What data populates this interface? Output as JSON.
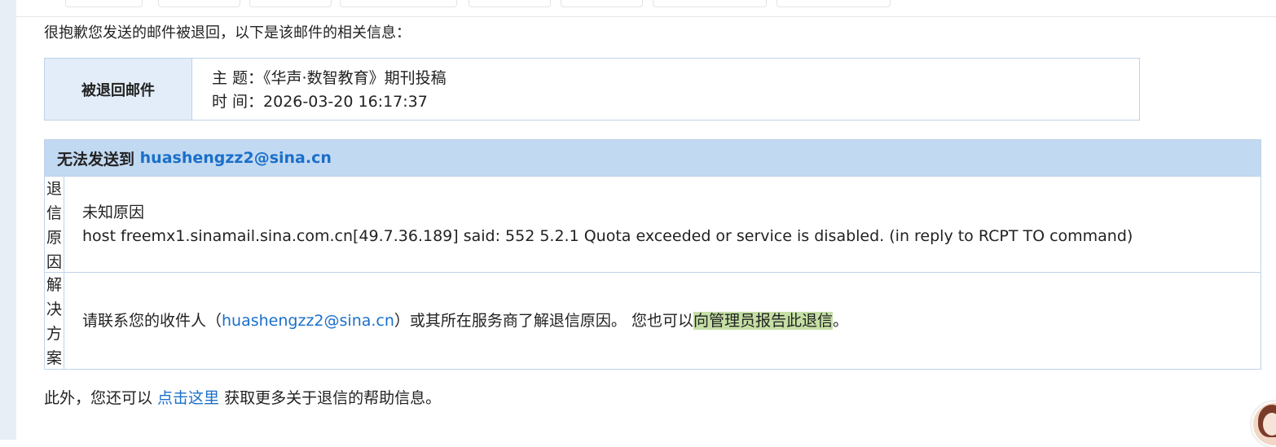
{
  "intro": "很抱歉您发送的邮件被退回，以下是该邮件的相关信息：",
  "bounced": {
    "label": "被退回邮件",
    "subject_label": "主 题：",
    "subject": "《华声·数智教育》期刊投稿",
    "time_label": "时 间：",
    "time": "2026-03-20 16:17:37"
  },
  "failure": {
    "header_prefix": "无法发送到",
    "recipient": "huashengzz2@sina.cn",
    "reason_label": [
      "退",
      "信",
      "原",
      "因"
    ],
    "reason_title": "未知原因",
    "reason_detail": "host freemx1.sinamail.sina.com.cn[49.7.36.189] said: 552 5.2.1 Quota exceeded or service is disabled. (in reply to RCPT TO command)",
    "solution_label": [
      "解",
      "决",
      "方",
      "案"
    ],
    "solution_prefix": "请联系您的收件人（",
    "solution_email": "huashengzz2@sina.cn",
    "solution_middle": "）或其所在服务商了解退信原因。 您也可以",
    "report_link": "向管理员报告此退信",
    "solution_suffix": "。"
  },
  "footer": {
    "prefix": "此外，您还可以 ",
    "help_link": "点击这里",
    "suffix": " 获取更多关于退信的帮助信息。"
  },
  "colors": {
    "header_bg": "#c2d9f2",
    "label_bg": "#e3edf9",
    "link": "#1a6fc9",
    "highlight": "#c5dfa5"
  }
}
